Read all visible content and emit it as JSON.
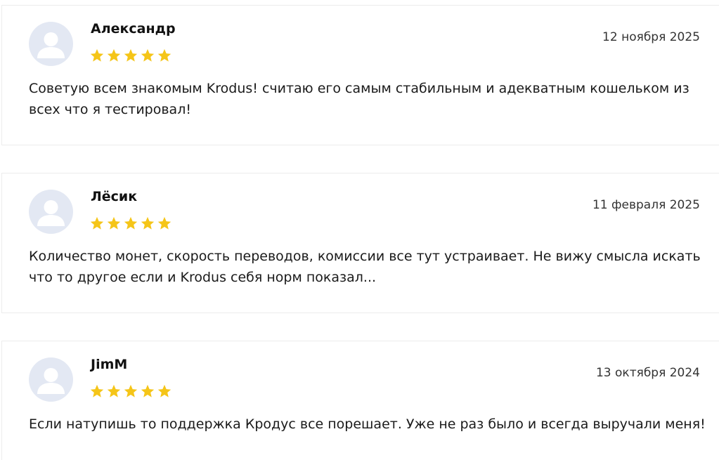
{
  "colors": {
    "star": "#f5c518",
    "avatar_bg": "#e3e8f3",
    "avatar_fg": "#ffffff"
  },
  "reviews": [
    {
      "author": "Александр",
      "date": "12 ноября 2025",
      "rating": 5,
      "text": "Советую всем знакомым Krodus! считаю его самым стабильным и адекватным кошельком из всех что я тестировал!"
    },
    {
      "author": "Лёсик",
      "date": "11 февраля 2025",
      "rating": 5,
      "text": "Количество монет, скорость переводов, комиссии все тут устраивает. Не вижу смысла искать что то другое если и Krodus себя норм показал..."
    },
    {
      "author": "JimM",
      "date": "13 октября 2024",
      "rating": 5,
      "text": "Если натупишь то поддержка Кродус все порешает. Уже не раз было и всегда выручали меня!"
    }
  ]
}
